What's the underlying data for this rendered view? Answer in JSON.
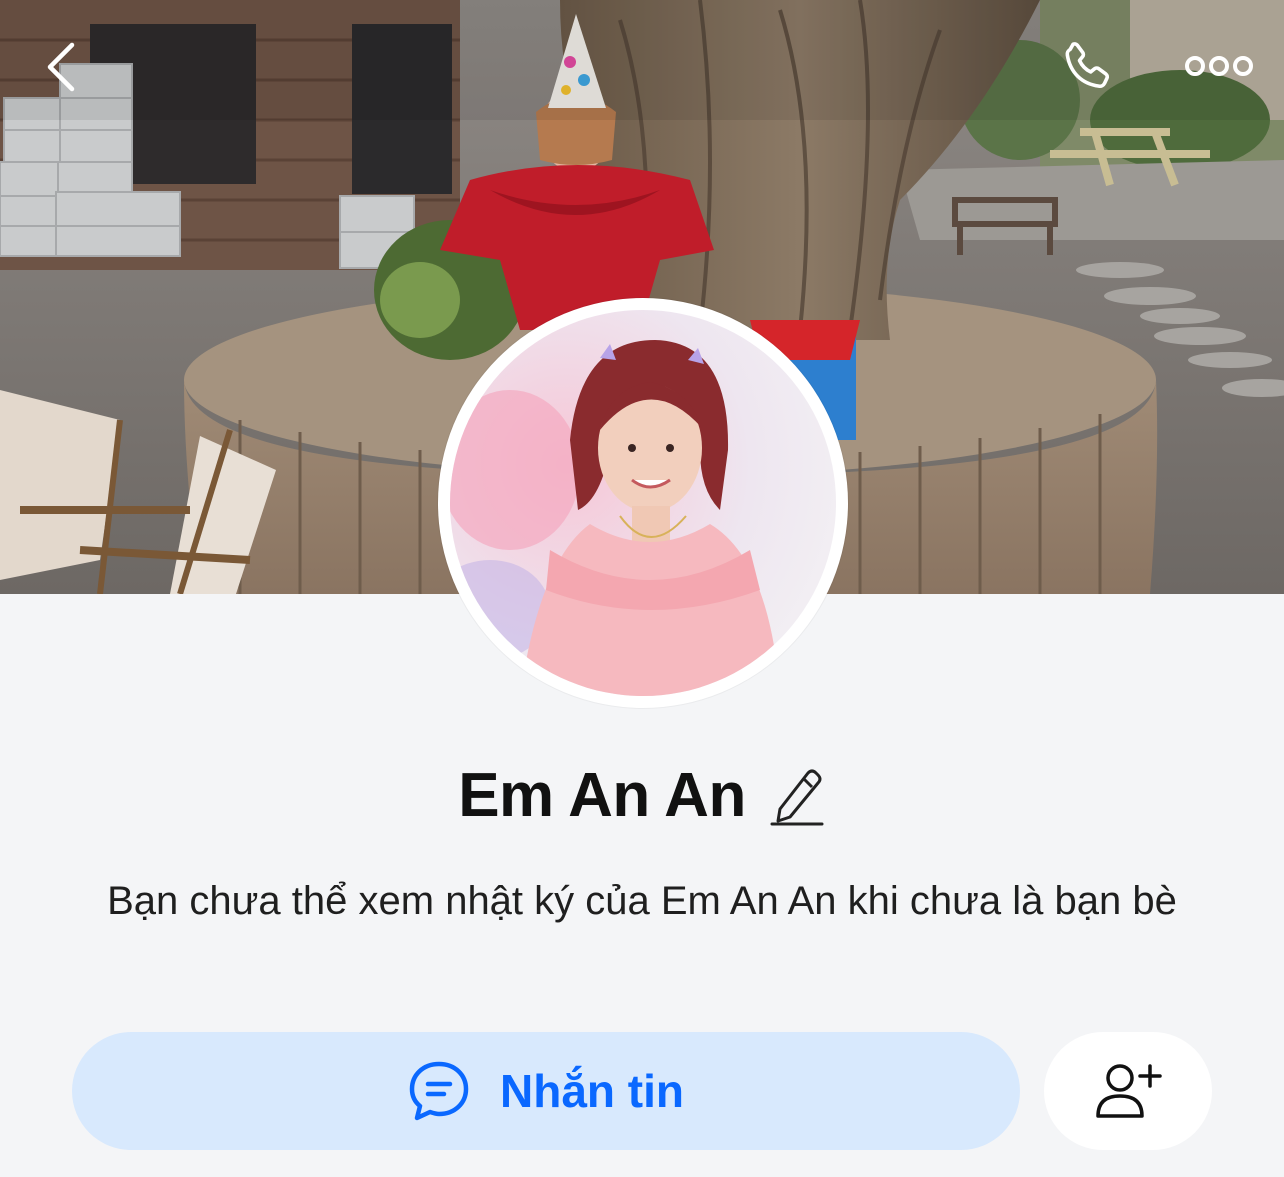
{
  "profile": {
    "name": "Em An An",
    "notice": "Bạn chưa thể xem nhật ký của Em An An khi chưa là bạn bè"
  },
  "actions": {
    "message_label": "Nhắn tin",
    "message_icon": "chat-bubble-icon",
    "add_friend_icon": "add-friend-icon"
  },
  "topbar": {
    "back_icon": "chevron-left-icon",
    "call_icon": "phone-icon",
    "more_icon": "more-dots-icon"
  },
  "colors": {
    "accent": "#0a68ff",
    "message_button_bg": "#d8e9fd",
    "page_bg": "#f4f5f7"
  }
}
